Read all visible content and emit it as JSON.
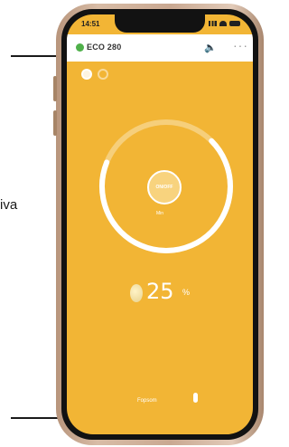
{
  "callout": {
    "text": "iva"
  },
  "status_bar": {
    "time": "14:51"
  },
  "header": {
    "device_name": "ECO 280",
    "speaker_icon": "speaker-icon",
    "more_icon": "more-icon"
  },
  "dial": {
    "button_text": "ON/OFF",
    "sub_label": "Min"
  },
  "temperature": {
    "value": "25",
    "unit": "%",
    "icon": "thermometer-icon"
  },
  "bottom": {
    "label": "Fopsom",
    "icon": "microphone-icon"
  },
  "colors": {
    "accent": "#f2b535",
    "status_green": "#4fb04a",
    "ring": "#ffffff"
  }
}
